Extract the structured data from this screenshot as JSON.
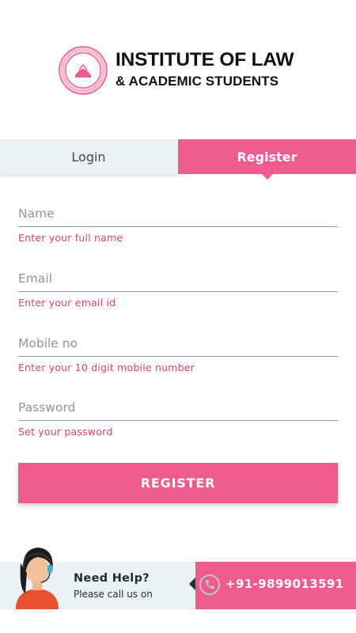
{
  "brand": {
    "line1": "INSTITUTE OF LAW",
    "line2": "& ACADEMIC STUDENTS",
    "logo_icon": "institute-seal-icon",
    "seal_color": "#ef5c8c"
  },
  "tabs": {
    "login_label": "Login",
    "register_label": "Register",
    "active": "Register"
  },
  "form": {
    "fields": [
      {
        "placeholder": "Name",
        "value": "",
        "hint": "Enter your full name"
      },
      {
        "placeholder": "Email",
        "value": "",
        "hint": "Enter your email id"
      },
      {
        "placeholder": "Mobile no",
        "value": "",
        "hint": "Enter your 10 digit mobile number"
      },
      {
        "placeholder": "Password",
        "value": "",
        "hint": "Set your password"
      }
    ],
    "submit_label": "REGISTER"
  },
  "help": {
    "title": "Need Help?",
    "subtitle": "Please call us on",
    "phone": "+91-9899013591",
    "agent_icon": "support-agent-icon",
    "phone_icon": "phone-icon"
  },
  "colors": {
    "accent": "#ef5c8c",
    "hint_text": "#e0416f",
    "tab_inactive_bg": "#eaf2f4"
  }
}
